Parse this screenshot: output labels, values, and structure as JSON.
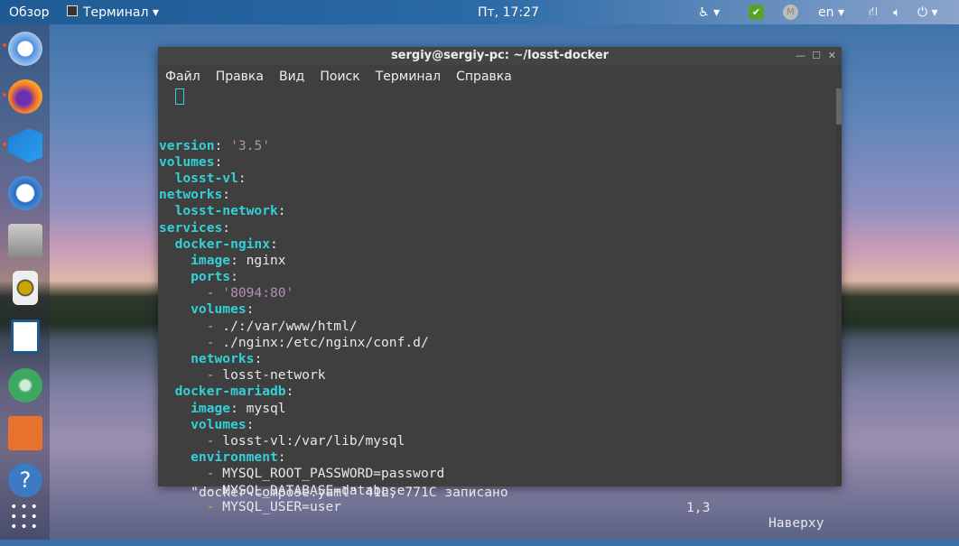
{
  "topbar": {
    "activities": "Обзор",
    "app": "Терминал",
    "clock": "Пт, 17:27",
    "lang": "en"
  },
  "dock": [
    "chromium-icon",
    "firefox-icon",
    "vscode-icon",
    "thunderbird-icon",
    "file-cabinet-icon",
    "speaker-icon",
    "writer-icon",
    "atom-icon",
    "software-center-icon",
    "help-icon",
    "apps-grid-icon"
  ],
  "window": {
    "title": "sergiy@sergiy-pc: ~/losst-docker",
    "menu": [
      "Файл",
      "Правка",
      "Вид",
      "Поиск",
      "Терминал",
      "Справка"
    ]
  },
  "lines": [
    [
      [
        "version",
        "k"
      ],
      [
        ": ",
        "p"
      ],
      [
        "'3.5'",
        "s"
      ]
    ],
    [
      [
        "volumes",
        "k"
      ],
      [
        ":",
        "p"
      ]
    ],
    [
      [
        "  losst-vl",
        "k"
      ],
      [
        ":",
        "p"
      ]
    ],
    [
      [
        "networks",
        "k"
      ],
      [
        ":",
        "p"
      ]
    ],
    [
      [
        "  losst-network",
        "k"
      ],
      [
        ":",
        "p"
      ]
    ],
    [
      [
        "services",
        "k"
      ],
      [
        ":",
        "p"
      ]
    ],
    [
      [
        "  docker-nginx",
        "k"
      ],
      [
        ":",
        "p"
      ]
    ],
    [
      [
        "    image",
        "k"
      ],
      [
        ": nginx",
        "v"
      ]
    ],
    [
      [
        "    ports",
        "k"
      ],
      [
        ":",
        "p"
      ]
    ],
    [
      [
        "      - ",
        "d"
      ],
      [
        "'8094:80'",
        "s"
      ]
    ],
    [
      [
        "    volumes",
        "k"
      ],
      [
        ":",
        "p"
      ]
    ],
    [
      [
        "      - ",
        "d"
      ],
      [
        "./:/var/www/html/",
        "v"
      ]
    ],
    [
      [
        "      - ",
        "d"
      ],
      [
        "./nginx:/etc/nginx/conf.d/",
        "v"
      ]
    ],
    [
      [
        "    networks",
        "k"
      ],
      [
        ":",
        "p"
      ]
    ],
    [
      [
        "      - ",
        "d"
      ],
      [
        "losst-network",
        "v"
      ]
    ],
    [
      [
        "  docker-mariadb",
        "k"
      ],
      [
        ":",
        "p"
      ]
    ],
    [
      [
        "    image",
        "k"
      ],
      [
        ": mysql",
        "v"
      ]
    ],
    [
      [
        "    volumes",
        "k"
      ],
      [
        ":",
        "p"
      ]
    ],
    [
      [
        "      - ",
        "d"
      ],
      [
        "losst-vl:/var/lib/mysql",
        "v"
      ]
    ],
    [
      [
        "    environment",
        "k"
      ],
      [
        ":",
        "p"
      ]
    ],
    [
      [
        "      - ",
        "d"
      ],
      [
        "MYSQL_ROOT_PASSWORD=password",
        "v"
      ]
    ],
    [
      [
        "      - ",
        "d"
      ],
      [
        "MYSQL_DATABASE=database",
        "v"
      ]
    ],
    [
      [
        "      - ",
        "d"
      ],
      [
        "MYSQL_USER=user",
        "v"
      ]
    ]
  ],
  "status": {
    "file": "\"docker-compose.yaml\" 41L, 771C записано",
    "pos": "1,3",
    "scroll": "Наверху"
  }
}
